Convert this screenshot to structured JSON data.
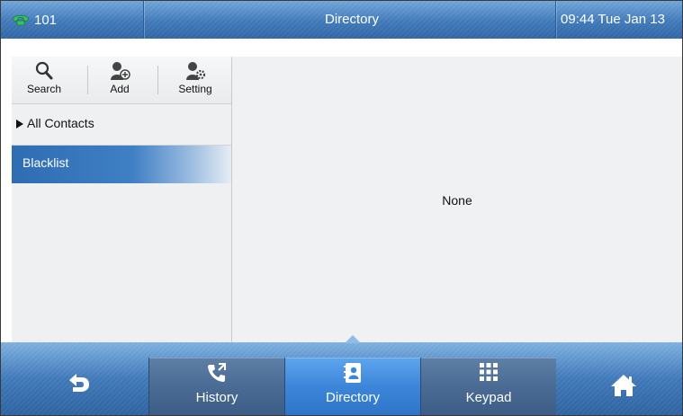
{
  "status_bar": {
    "account": "101",
    "title": "Directory",
    "datetime": "09:44 Tue Jan 13"
  },
  "toolbar": {
    "search_label": "Search",
    "add_label": "Add",
    "setting_label": "Setting"
  },
  "groups": [
    {
      "label": "All Contacts",
      "expandable": true
    },
    {
      "label": "Blacklist",
      "selected": true
    }
  ],
  "content": {
    "empty_text": "None"
  },
  "softkeys": {
    "history_label": "History",
    "directory_label": "Directory",
    "keypad_label": "Keypad"
  },
  "colors": {
    "accent": "#3c86da",
    "bar_blue": "#3f78b8",
    "line_status_green": "#2fbf5a"
  },
  "icons": {
    "account": "phone-handset-icon",
    "back": "back-arrow-icon",
    "home": "home-icon",
    "search": "search-icon",
    "add": "add-contact-icon",
    "setting": "contact-setting-icon",
    "history": "call-history-icon",
    "directory": "directory-book-icon",
    "keypad": "keypad-icon"
  }
}
